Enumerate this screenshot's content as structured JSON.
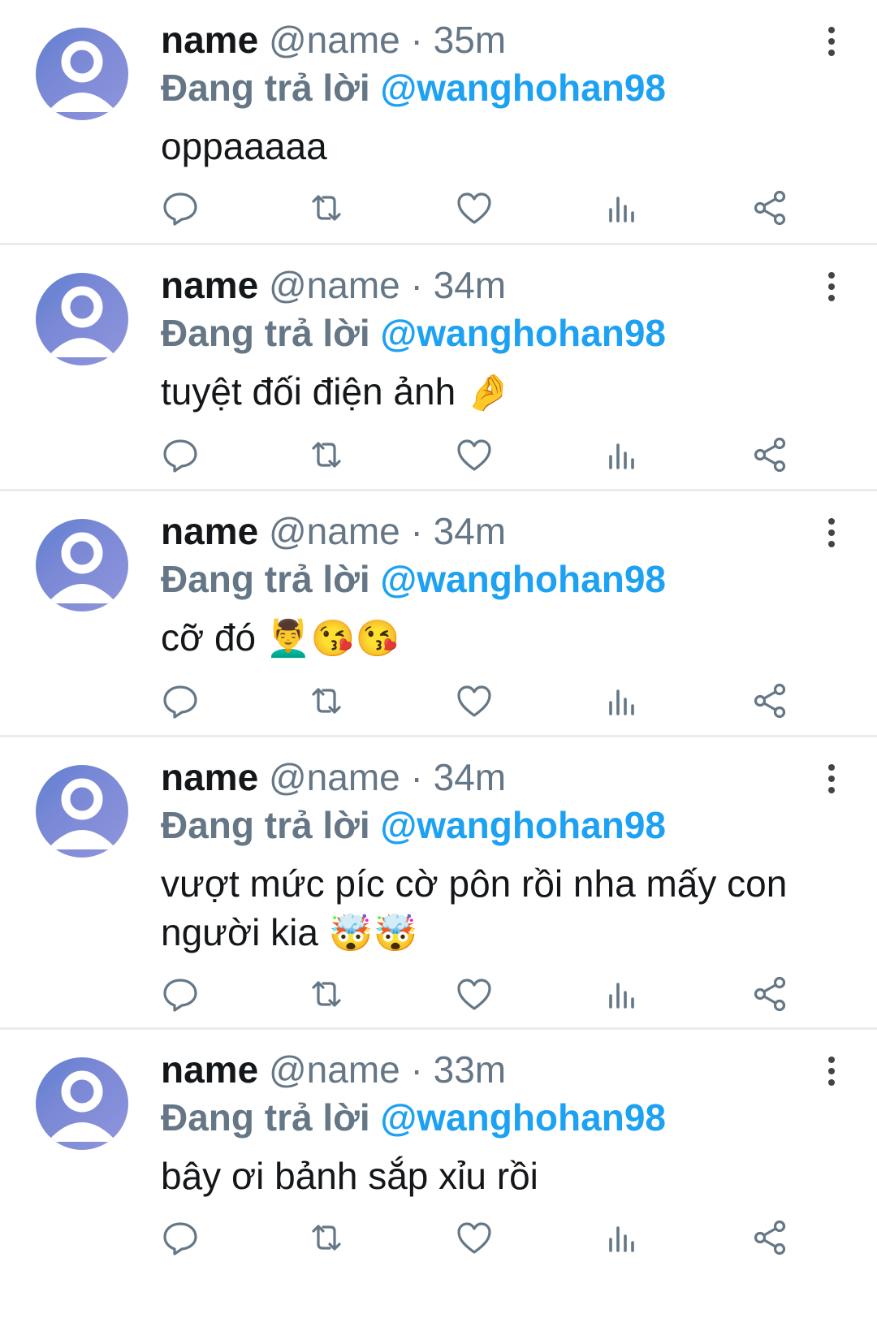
{
  "tweets": [
    {
      "name": "name",
      "handle": "@name",
      "sep": "·",
      "time": "35m",
      "reply_prefix": "Đang trả lời",
      "mention": "@wanghohan98",
      "text": "oppaaaaa",
      "emojis": ""
    },
    {
      "name": "name",
      "handle": "@name",
      "sep": "·",
      "time": "34m",
      "reply_prefix": "Đang trả lời",
      "mention": "@wanghohan98",
      "text": "tuyệt đối điện ảnh",
      "emojis": "🤌"
    },
    {
      "name": "name",
      "handle": "@name",
      "sep": "·",
      "time": "34m",
      "reply_prefix": "Đang trả lời",
      "mention": "@wanghohan98",
      "text": "cỡ đó",
      "emojis": "💆‍♂️😘😘"
    },
    {
      "name": "name",
      "handle": "@name",
      "sep": "·",
      "time": "34m",
      "reply_prefix": "Đang trả lời",
      "mention": "@wanghohan98",
      "text": "vượt mức píc cờ pôn rồi nha mấy con người kia",
      "emojis": "🤯🤯"
    },
    {
      "name": "name",
      "handle": "@name",
      "sep": "·",
      "time": "33m",
      "reply_prefix": "Đang trả lời",
      "mention": "@wanghohan98",
      "text": "bây ơi bảnh sắp xỉu rồi",
      "emojis": ""
    }
  ],
  "icons": {
    "avatar": "default-user-avatar",
    "more": "more-vertical-icon",
    "reply": "reply-icon",
    "retweet": "retweet-icon",
    "like": "heart-icon",
    "stats": "analytics-icon",
    "share": "share-icon"
  },
  "colors": {
    "text": "#14171a",
    "secondary": "#657786",
    "mention": "#1da1f2",
    "divider": "#e9ecef"
  }
}
